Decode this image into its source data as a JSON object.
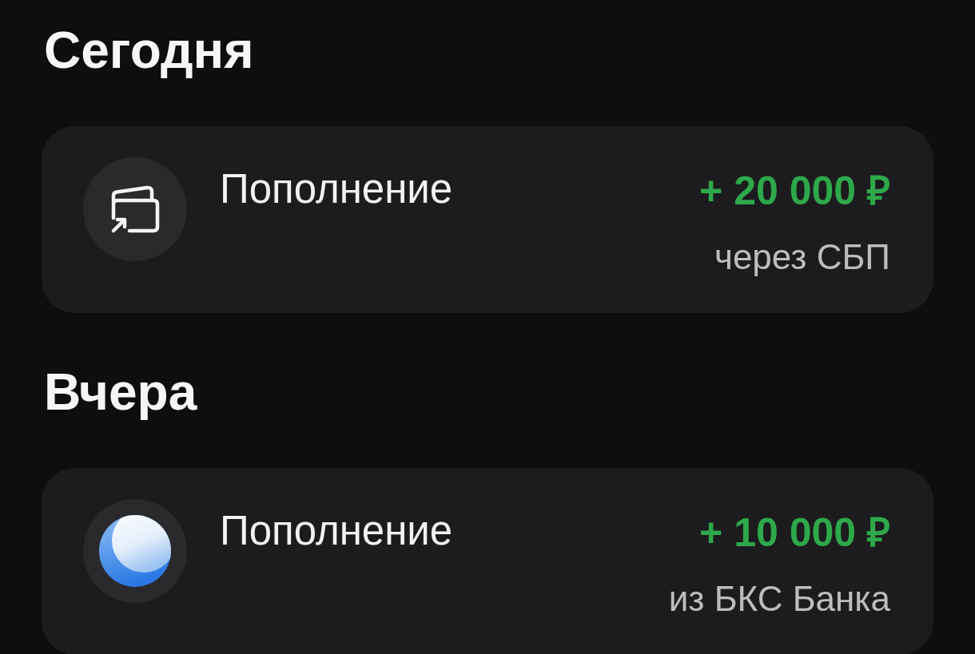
{
  "sections": [
    {
      "title": "Сегодня",
      "transactions": [
        {
          "kind": "wallet",
          "title": "Пополнение",
          "amount": "+ 20 000 ₽",
          "source": "через СБП"
        }
      ]
    },
    {
      "title": "Вчера",
      "transactions": [
        {
          "kind": "sphere",
          "title": "Пополнение",
          "amount": "+ 10 000 ₽",
          "source": "из БКС Банка"
        }
      ]
    }
  ]
}
